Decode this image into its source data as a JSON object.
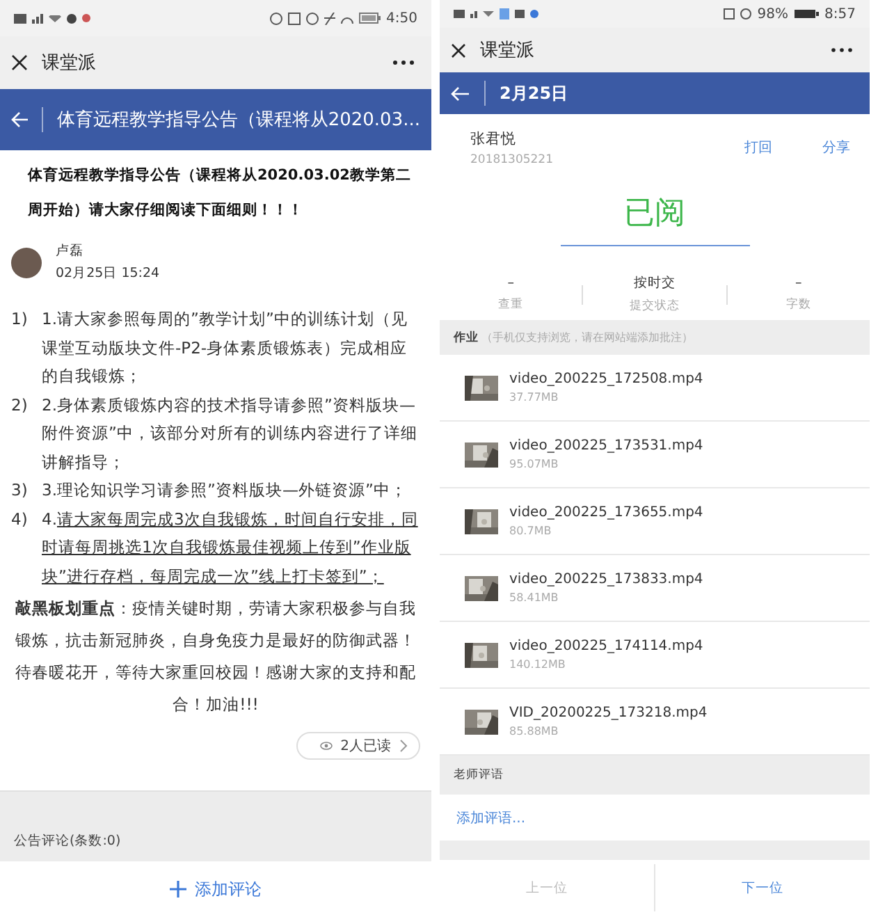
{
  "left": {
    "status_bar": {
      "time": "4:50"
    },
    "title_bar": {
      "title": "课堂派"
    },
    "header": {
      "title": "体育远程教学指导公告（课程将从2020.03..."
    },
    "post": {
      "title": "体育远程教学指导公告（课程将从2020.03.02教学第二周开始）请大家仔细阅读下面细则！！！",
      "author": "卢磊",
      "date": "02月25日 15:24",
      "items": [
        {
          "marker": "1)",
          "lead": "1.",
          "text": "请大家参照每周的”教学计划”中的训练计划（见课堂互动版块文件-P2-身体素质锻炼表）完成相应的自我锻炼；",
          "underlined": false
        },
        {
          "marker": "2)",
          "lead": "2.",
          "text": "身体素质锻炼内容的技术指导请参照”资料版块—附件资源”中，该部分对所有的训练内容进行了详细讲解指导；",
          "underlined": false
        },
        {
          "marker": "3)",
          "lead": "3.",
          "text": "理论知识学习请参照”资料版块—外链资源”中；",
          "underlined": false
        },
        {
          "marker": "4)",
          "lead": "4.",
          "text": "请大家每周完成3次自我锻炼，时间自行安排，同时请每周挑选1次自我锻炼最佳视频上传到”作业版块”进行存档，每周完成一次”线上打卡签到”；",
          "underlined": true
        }
      ],
      "note": "**敲黑板划重点**：疫情关键时期，劳请大家积极参与自我锻炼，抗击新冠肺炎，自身免疫力是最好的防御武器！待春暖花开，等待大家重回校园！感谢大家的支持和配合！加油!!!",
      "read_count": "2人已读"
    },
    "comments": {
      "header": "公告评论(条数:0)",
      "add_button": "添加评论"
    }
  },
  "right": {
    "status_bar": {
      "battery": "98%",
      "time": "8:57"
    },
    "title_bar": {
      "title": "课堂派"
    },
    "header": {
      "title": "2月25日"
    },
    "student": {
      "name": "张君悦",
      "id": "20181305221",
      "actions": [
        "打回",
        "分享"
      ]
    },
    "status": "已阅",
    "stats": [
      {
        "value": "–",
        "label": "查重"
      },
      {
        "value": "按时交",
        "label": "提交状态"
      },
      {
        "value": "–",
        "label": "字数"
      }
    ],
    "homework": {
      "title": "作业",
      "hint": "（手机仅支持浏览，请在网站端添加批注）",
      "files": [
        {
          "name": "video_200225_172508.mp4",
          "size": "37.77MB"
        },
        {
          "name": "video_200225_173531.mp4",
          "size": "95.07MB"
        },
        {
          "name": "video_200225_173655.mp4",
          "size": "80.7MB"
        },
        {
          "name": "video_200225_173833.mp4",
          "size": "58.41MB"
        },
        {
          "name": "video_200225_174114.mp4",
          "size": "140.12MB"
        },
        {
          "name": "VID_20200225_173218.mp4",
          "size": "85.88MB"
        }
      ]
    },
    "review": {
      "header": "老师评语",
      "add_link": "添加评语..."
    },
    "nav": {
      "prev": "上一位",
      "next": "下一位"
    }
  }
}
